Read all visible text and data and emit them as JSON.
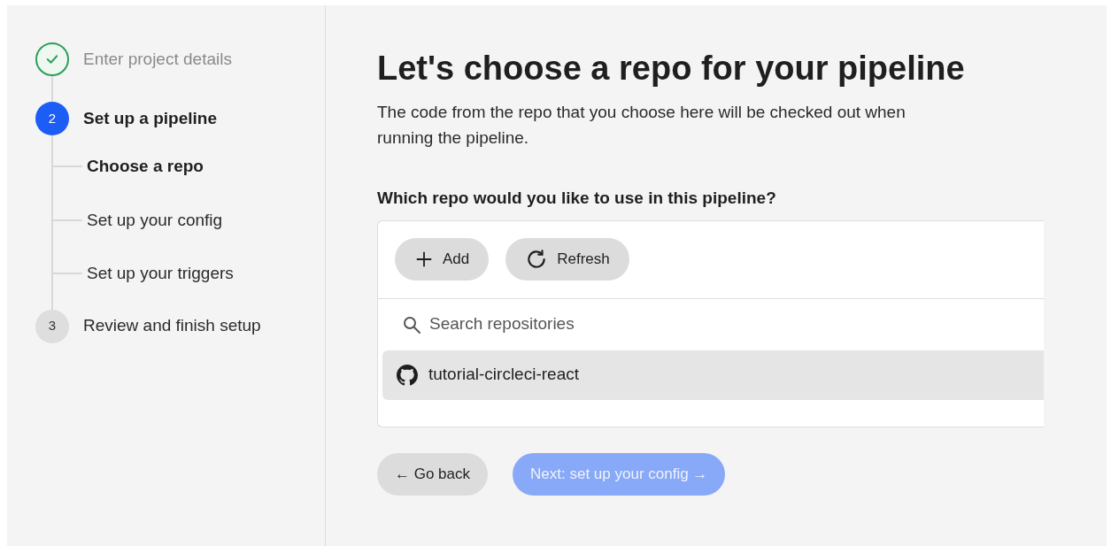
{
  "steps": [
    {
      "kind": "done",
      "label": "Enter project details"
    },
    {
      "kind": "current",
      "marker": "2",
      "label": "Set up a pipeline",
      "children": [
        {
          "label": "Choose a repo",
          "selected": true
        },
        {
          "label": "Set up your config",
          "selected": false
        },
        {
          "label": "Set up your triggers",
          "selected": false
        }
      ]
    },
    {
      "kind": "upcoming",
      "marker": "3",
      "label": "Review and finish setup"
    }
  ],
  "title": "Let's choose a repo for your pipeline",
  "description": "The code from the repo that you choose here will be checked out when running the pipeline.",
  "question": "Which repo would you like to use in this pipeline?",
  "toolbar": [
    {
      "kind": "add",
      "label": "Add"
    },
    {
      "kind": "refresh",
      "label": "Refresh"
    }
  ],
  "search": {
    "placeholder": "Search repositories"
  },
  "repos": [
    {
      "name": "tutorial-circleci-react",
      "selected": true
    }
  ],
  "back_button": {
    "label": "← Go back"
  },
  "next_button": {
    "label": "Next: set up your config →",
    "disabled": true
  }
}
